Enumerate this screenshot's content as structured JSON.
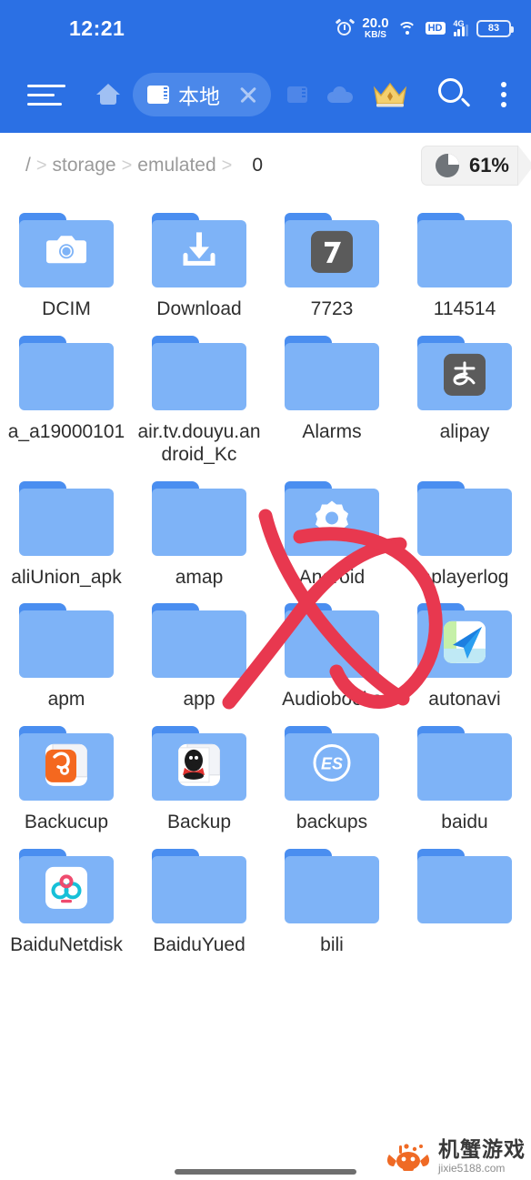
{
  "statusbar": {
    "time": "12:21",
    "network_speed_value": "20.0",
    "network_speed_unit": "KB/S",
    "hd_label": "HD",
    "network_type": "4G",
    "battery_level": "83",
    "icons": [
      "alarm-icon",
      "wifi-icon",
      "hd-icon",
      "signal-icon",
      "battery-icon"
    ]
  },
  "toolbar": {
    "menu_icon": "hamburger-menu-icon",
    "home_icon": "home-icon",
    "tab": {
      "label": "本地",
      "icon": "sd-card-icon",
      "close_icon": "close-icon"
    },
    "sdcard_icon": "sd-card-icon",
    "cloud_icon": "cloud-icon",
    "vip_icon": "crown-icon",
    "search_icon": "search-icon",
    "overflow_icon": "more-vertical-icon"
  },
  "breadcrumb": {
    "root": "/",
    "separator": ">",
    "segments": [
      "storage",
      "emulated"
    ],
    "current": "0"
  },
  "storage": {
    "percent": "61%",
    "icon": "pie-chart-icon"
  },
  "files": [
    {
      "name": "DCIM",
      "badge": "camera-icon",
      "badge_style": "none"
    },
    {
      "name": "Download",
      "badge": "download-icon",
      "badge_style": "none"
    },
    {
      "name": "7723",
      "badge": "7723-app-icon",
      "badge_style": "dark"
    },
    {
      "name": "114514",
      "badge": "",
      "badge_style": "none"
    },
    {
      "name": "a_a19000101",
      "badge": "",
      "badge_style": "none"
    },
    {
      "name": "air.tv.douyu.android_Kc",
      "badge": "",
      "badge_style": "none"
    },
    {
      "name": "Alarms",
      "badge": "",
      "badge_style": "none"
    },
    {
      "name": "alipay",
      "badge": "alipay-icon",
      "badge_style": "dark"
    },
    {
      "name": "aliUnion_apk",
      "badge": "",
      "badge_style": "none"
    },
    {
      "name": "amap",
      "badge": "",
      "badge_style": "none"
    },
    {
      "name": "Android",
      "badge": "android-gear-icon",
      "badge_style": "none"
    },
    {
      "name": "aplayerlog",
      "badge": "",
      "badge_style": "none"
    },
    {
      "name": "apm",
      "badge": "",
      "badge_style": "none"
    },
    {
      "name": "app",
      "badge": "",
      "badge_style": "none"
    },
    {
      "name": "Audiobooks",
      "badge": "",
      "badge_style": "none"
    },
    {
      "name": "autonavi",
      "badge": "autonavi-icon",
      "badge_style": "white"
    },
    {
      "name": "Backucup",
      "badge": "uc-browser-icon",
      "badge_style": "white"
    },
    {
      "name": "Backup",
      "badge": "qq-icon",
      "badge_style": "white"
    },
    {
      "name": "backups",
      "badge": "es-explorer-icon",
      "badge_style": "none"
    },
    {
      "name": "baidu",
      "badge": "",
      "badge_style": "none"
    },
    {
      "name": "BaiduNetdisk",
      "badge": "baidu-netdisk-icon",
      "badge_style": "white"
    },
    {
      "name": "BaiduYued",
      "badge": "",
      "badge_style": "none"
    },
    {
      "name": "bili",
      "badge": "",
      "badge_style": "none"
    },
    {
      "name": "",
      "badge": "",
      "badge_style": "none"
    }
  ],
  "annotation": {
    "type": "handwritten-marker",
    "color": "#e8384f",
    "shapes": [
      "x-stroke",
      "circle-around-android-folder"
    ],
    "target": "Android"
  },
  "watermark": {
    "cn": "机蟹游戏",
    "url": "jixie5188.com"
  }
}
